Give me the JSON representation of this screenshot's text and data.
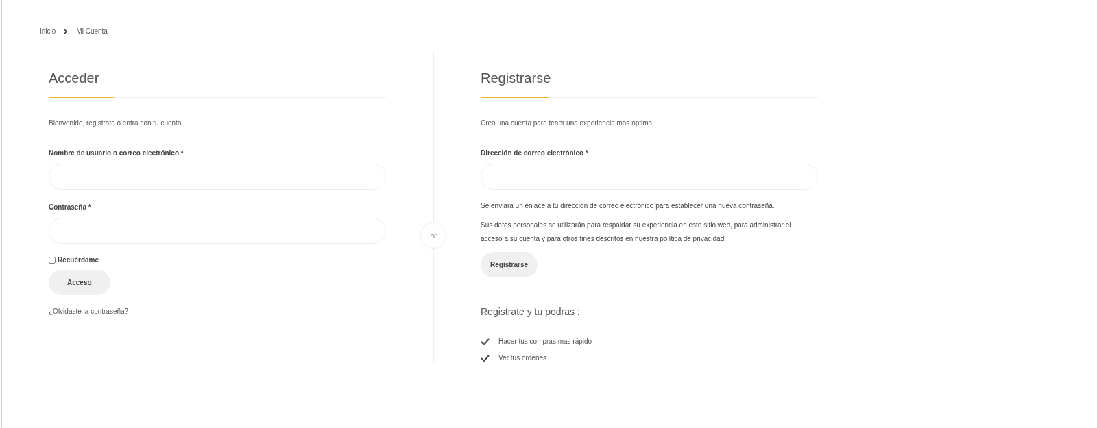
{
  "breadcrumb": [
    {
      "label": "Inicio"
    },
    {
      "label": "Mi Cuenta"
    }
  ],
  "login": {
    "title": "Acceder",
    "intro": "Bienvenido, registrate o entra con tu cuenta",
    "fields": [
      {
        "label": "Nombre de usuario o correo electrónico *"
      },
      {
        "label": "Contraseña *"
      }
    ],
    "remember": {
      "label": "Recuérdame",
      "checked": false
    },
    "button": "Acceso",
    "forgot": "¿Olvidaste la contraseña?"
  },
  "separator": "or",
  "register": {
    "title": "Registrarse",
    "intro": "Crea una cuenta para tener una experiencia mas óptima",
    "fields": [
      {
        "label": "Dirección de correo electrónico *"
      }
    ],
    "notes": [
      "Se enviará un enlace a tu dirección de correo electrónico para establecer una nueva contraseña.",
      "Sus datos personales se utilizarán para respaldar su experiencia en este sitio web, para administrar el acceso a su cuenta y para otros fines descritos en nuestra política de privacidad."
    ],
    "button": "Registrarse",
    "benefits_title": "Registrate y tu podras :",
    "benefits": [
      "Hacer tus compras mas rápido",
      "Ver tus ordenes"
    ]
  }
}
